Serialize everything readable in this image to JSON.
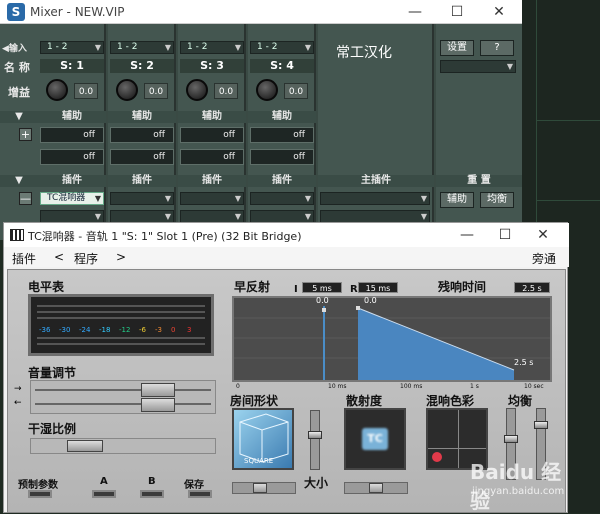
{
  "mixer": {
    "title": "Mixer - NEW.VIP",
    "window_buttons": [
      "—",
      "☐",
      "✕"
    ],
    "input_label": "◀输入",
    "name_label": "名 称",
    "gain_label": "增益",
    "aux_label": "辅助",
    "insert_label": "插件",
    "master_insert_label": "主插件",
    "reset_label": "重 置",
    "note": "常工汉化",
    "settings_button": "设置",
    "help_button": "?",
    "aux_button": "辅助",
    "pan_button": "均衡",
    "strips": [
      {
        "input": "1 - 2",
        "name": "S: 1",
        "gain": "0.0",
        "aux": [
          "off",
          "off"
        ],
        "insert": "TC混响器"
      },
      {
        "input": "1 - 2",
        "name": "S: 2",
        "gain": "0.0",
        "aux": [
          "off",
          "off"
        ],
        "insert": ""
      },
      {
        "input": "1 - 2",
        "name": "S: 3",
        "gain": "0.0",
        "aux": [
          "off",
          "off"
        ],
        "insert": ""
      },
      {
        "input": "1 - 2",
        "name": "S: 4",
        "gain": "0.0",
        "aux": [
          "off",
          "off"
        ],
        "insert": ""
      }
    ],
    "plus": "+",
    "minus": "—"
  },
  "tc": {
    "title": "TC混响器 - 音轨 1  \"S:  1\" Slot 1 (Pre) (32 Bit Bridge)",
    "window_buttons": [
      "—",
      "☐",
      "✕"
    ],
    "menu": {
      "plugin": "插件",
      "prev": "<",
      "program": "程序",
      "next": ">",
      "bypass": "旁通"
    },
    "level_meter_label": "电平表",
    "meter_scale": [
      "-36",
      "-30",
      "-24",
      "-18",
      "-12",
      "-6",
      "-3",
      "0",
      "3"
    ],
    "volume_label": "音量调节",
    "drywet_label": "干湿比例",
    "early_label": "早反射",
    "early_i": "I",
    "early_i_val": "5 ms",
    "early_r": "R",
    "early_r_val": "15 ms",
    "reverb_time_label": "残响时间",
    "reverb_time_val": "2.5 s",
    "display_val1": "0.0",
    "display_val2": "0.0",
    "display_val3": "2.5 s",
    "axis": [
      "0",
      "10 ms",
      "100 ms",
      "1 s",
      "10 sec"
    ],
    "room_shape_label": "房间形状",
    "room_shape_value": "SQUARE",
    "diffusion_label": "散射度",
    "color_label": "混响色彩",
    "balance_label": "均衡",
    "size_label": "大小",
    "preset_label": "预制参数",
    "a_label": "A",
    "b_label": "B",
    "save_label": "保存",
    "tc_logo": "TC"
  },
  "watermark": {
    "brand": "Baidu 经验",
    "url": "jingyan.baidu.com"
  }
}
